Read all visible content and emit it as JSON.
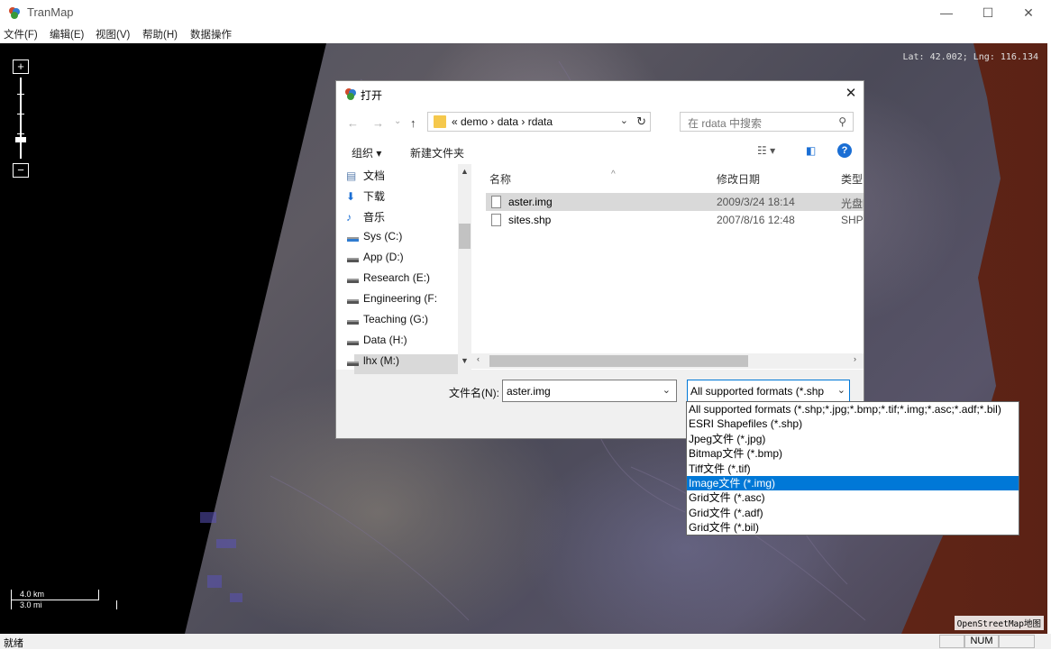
{
  "app": {
    "title": "TranMap",
    "minimize": "—",
    "maximize": "☐",
    "close": "✕"
  },
  "menu": [
    "文件(F)",
    "编辑(E)",
    "视图(V)",
    "帮助(H)",
    "数据操作"
  ],
  "map": {
    "zoom_in": "+",
    "zoom_out": "−",
    "zoom_level_fraction": 0.82,
    "coords": "Lat: 42.002; Lng: 116.134",
    "scale_km": "4.0 km",
    "scale_mi": "3.0 mi",
    "attribution": "OpenStreetMap地图"
  },
  "status": {
    "text": "就绪",
    "num": "NUM"
  },
  "dialog": {
    "title": "打开",
    "close": "✕",
    "nav": {
      "back": "←",
      "forward": "→",
      "history": "⌄",
      "up": "↑"
    },
    "crumbs": "«  demo  ›  data  ›  rdata",
    "search_placeholder": "在 rdata 中搜索",
    "organize": "组织 ▾",
    "new_folder": "新建文件夹",
    "help": "?",
    "nav_items": [
      {
        "label": "文档",
        "icon": "document-icon"
      },
      {
        "label": "下载",
        "icon": "download-icon"
      },
      {
        "label": "音乐",
        "icon": "music-icon"
      },
      {
        "label": "Sys (C:)",
        "icon": "drive-icon"
      },
      {
        "label": "App (D:)",
        "icon": "drive-icon"
      },
      {
        "label": "Research (E:)",
        "icon": "drive-icon"
      },
      {
        "label": "Engineering (F:",
        "icon": "drive-icon"
      },
      {
        "label": "Teaching (G:)",
        "icon": "drive-icon"
      },
      {
        "label": "Data (H:)",
        "icon": "drive-icon"
      },
      {
        "label": "lhx (M:)",
        "icon": "drive-icon"
      }
    ],
    "columns": {
      "name": "名称",
      "date": "修改日期",
      "type": "类型"
    },
    "files": [
      {
        "name": "aster.img",
        "date": "2009/3/24 18:14",
        "type": "光盘映",
        "selected": true
      },
      {
        "name": "sites.shp",
        "date": "2007/8/16 12:48",
        "type": "SHP",
        "selected": false
      }
    ],
    "filename_label": "文件名(N):",
    "filename_value": "aster.img",
    "filter_value": "All supported formats (*.shp"
  },
  "filter_options": [
    "All supported formats (*.shp;*.jpg;*.bmp;*.tif;*.img;*.asc;*.adf;*.bil)",
    "ESRI Shapefiles (*.shp)",
    "Jpeg文件 (*.jpg)",
    "Bitmap文件 (*.bmp)",
    "Tiff文件 (*.tif)",
    "Image文件 (*.img)",
    "Grid文件 (*.asc)",
    "Grid文件 (*.adf)",
    "Grid文件 (*.bil)"
  ],
  "filter_selected_index": 5,
  "colors": {
    "accent": "#0078d7",
    "selection": "#d9d9d9",
    "sea": "#6e2d1a"
  }
}
